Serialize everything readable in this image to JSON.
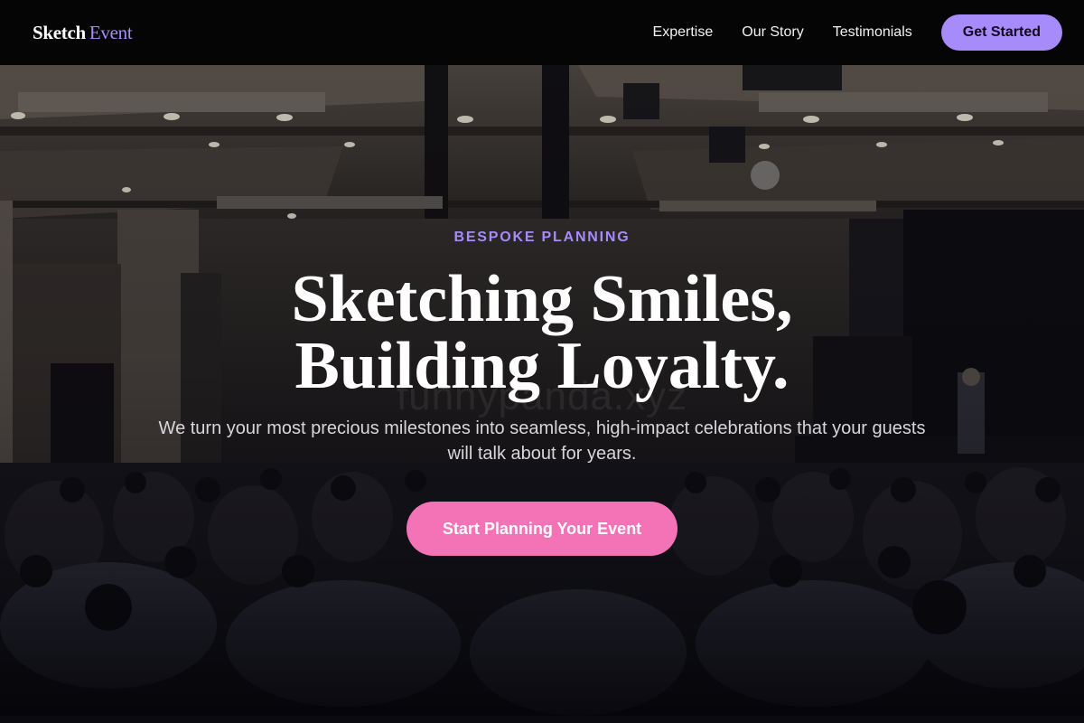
{
  "nav": {
    "logo_part1": "Sketch",
    "logo_part2": "Event",
    "links": [
      "Expertise",
      "Our Story",
      "Testimonials"
    ],
    "cta_label": "Get Started"
  },
  "hero": {
    "eyebrow": "BESPOKE PLANNING",
    "headline_line1": "Sketching Smiles,",
    "headline_line2": "Building Loyalty.",
    "subtitle": "We turn your most precious milestones into seamless, high-impact celebrations that your guests will talk about for years.",
    "cta_label": "Start Planning Your Event",
    "watermark": "funnypanda.xyz"
  },
  "colors": {
    "accent_purple": "#a78bfa",
    "accent_pink": "#f472b6",
    "nav_bg": "#050505"
  }
}
